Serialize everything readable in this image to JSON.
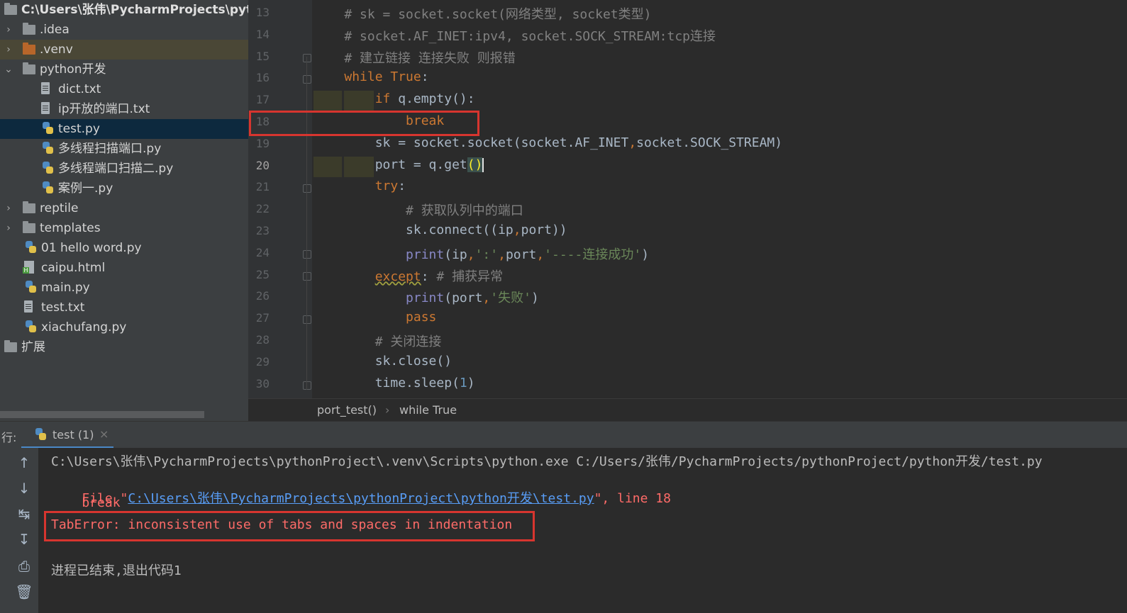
{
  "project_tree": {
    "root_path": "C:\\Users\\张伟\\PycharmProjects\\pytho",
    "items": [
      {
        "label": ".idea",
        "type": "folder",
        "expanded": false
      },
      {
        "label": ".venv",
        "type": "folder",
        "expanded": false,
        "icon_color": "#b8662a",
        "highlighted": true
      },
      {
        "label": "python开发",
        "type": "folder",
        "expanded": true
      },
      {
        "label": "dict.txt",
        "type": "txt"
      },
      {
        "label": "ip开放的端口.txt",
        "type": "txt"
      },
      {
        "label": "test.py",
        "type": "py",
        "selected": true
      },
      {
        "label": "多线程扫描端口.py",
        "type": "py"
      },
      {
        "label": "多线程端口扫描二.py",
        "type": "py"
      },
      {
        "label": "案例一.py",
        "type": "py"
      },
      {
        "label": "reptile",
        "type": "folder",
        "expanded": false
      },
      {
        "label": "templates",
        "type": "folder",
        "expanded": false
      },
      {
        "label": "01 hello word.py",
        "type": "py"
      },
      {
        "label": "caipu.html",
        "type": "html"
      },
      {
        "label": "main.py",
        "type": "py"
      },
      {
        "label": "test.txt",
        "type": "txt"
      },
      {
        "label": "xiachufang.py",
        "type": "py"
      },
      {
        "label": "扩展",
        "type": "folder"
      }
    ]
  },
  "editor": {
    "current_line": 20,
    "lines": [
      {
        "num": "13",
        "tokens": [
          {
            "t": "    # sk = socket.socket(网络类型, socket类型)",
            "c": "cm"
          }
        ]
      },
      {
        "num": "14",
        "tokens": [
          {
            "t": "    # socket.AF_INET:ipv4, socket.SOCK_STREAM:tcp连接",
            "c": "cm"
          }
        ]
      },
      {
        "num": "15",
        "tokens": [
          {
            "t": "    # 建立链接 连接失败 则报错",
            "c": "cm"
          }
        ]
      },
      {
        "num": "16",
        "tokens": [
          {
            "t": "    ",
            "c": ""
          },
          {
            "t": "while True",
            "c": "kw"
          },
          {
            "t": ":",
            "c": ""
          }
        ]
      },
      {
        "num": "17",
        "tokens": [
          {
            "t": "        ",
            "c": ""
          },
          {
            "t": "if",
            "c": "kw"
          },
          {
            "t": " q.empty():",
            "c": ""
          }
        ]
      },
      {
        "num": "18",
        "tokens": [
          {
            "t": "            ",
            "c": ""
          },
          {
            "t": "break",
            "c": "kw"
          }
        ]
      },
      {
        "num": "19",
        "tokens": [
          {
            "t": "        sk = socket.socket(socket.AF_INET",
            "c": ""
          },
          {
            "t": ",",
            "c": "kw"
          },
          {
            "t": "socket.SOCK_STREAM)",
            "c": ""
          }
        ]
      },
      {
        "num": "20",
        "tokens": [
          {
            "t": "        port = q.get",
            "c": ""
          },
          {
            "t": "()",
            "c": "brk"
          }
        ]
      },
      {
        "num": "21",
        "tokens": [
          {
            "t": "        ",
            "c": ""
          },
          {
            "t": "try",
            "c": "kw"
          },
          {
            "t": ":",
            "c": ""
          }
        ]
      },
      {
        "num": "22",
        "tokens": [
          {
            "t": "            # 获取队列中的端口",
            "c": "cm"
          }
        ]
      },
      {
        "num": "23",
        "tokens": [
          {
            "t": "            sk.connect((ip",
            "c": ""
          },
          {
            "t": ",",
            "c": "kw"
          },
          {
            "t": "port))",
            "c": ""
          }
        ]
      },
      {
        "num": "24",
        "tokens": [
          {
            "t": "            ",
            "c": ""
          },
          {
            "t": "print",
            "c": "bi"
          },
          {
            "t": "(ip",
            "c": ""
          },
          {
            "t": ",",
            "c": "kw"
          },
          {
            "t": "':'",
            "c": "st"
          },
          {
            "t": ",",
            "c": "kw"
          },
          {
            "t": "port",
            "c": ""
          },
          {
            "t": ",",
            "c": "kw"
          },
          {
            "t": "'----连接成功'",
            "c": "st"
          },
          {
            "t": ")",
            "c": ""
          }
        ]
      },
      {
        "num": "25",
        "tokens": [
          {
            "t": "        ",
            "c": ""
          },
          {
            "t": "except",
            "c": "kw"
          },
          {
            "t": ": ",
            "c": ""
          },
          {
            "t": "# 捕获异常",
            "c": "cm"
          }
        ]
      },
      {
        "num": "26",
        "tokens": [
          {
            "t": "            ",
            "c": ""
          },
          {
            "t": "print",
            "c": "bi"
          },
          {
            "t": "(port",
            "c": ""
          },
          {
            "t": ",",
            "c": "kw"
          },
          {
            "t": "'失败'",
            "c": "st"
          },
          {
            "t": ")",
            "c": ""
          }
        ]
      },
      {
        "num": "27",
        "tokens": [
          {
            "t": "            ",
            "c": ""
          },
          {
            "t": "pass",
            "c": "kw"
          }
        ]
      },
      {
        "num": "28",
        "tokens": [
          {
            "t": "        # 关闭连接",
            "c": "cm"
          }
        ]
      },
      {
        "num": "29",
        "tokens": [
          {
            "t": "        sk.close()",
            "c": ""
          }
        ]
      },
      {
        "num": "30",
        "tokens": [
          {
            "t": "        time.sleep(",
            "c": ""
          },
          {
            "t": "1",
            "c": "nm"
          },
          {
            "t": ")",
            "c": ""
          }
        ]
      }
    ],
    "breadcrumb": {
      "item1": "port_test()",
      "separator": "›",
      "item2": "while True"
    }
  },
  "run_panel": {
    "run_label": "行:",
    "tab_label": "test (1)",
    "close_glyph": "×",
    "output": {
      "command": "C:\\Users\\张伟\\PycharmProjects\\pythonProject\\.venv\\Scripts\\python.exe C:/Users/张伟/PycharmProjects/pythonProject/python开发/test.py",
      "file_prefix": "  File \"",
      "file_link": "C:\\Users\\张伟\\PycharmProjects\\pythonProject\\python开发\\test.py",
      "file_suffix": "\", line 18",
      "error_line": "    break",
      "error_message": "TabError: inconsistent use of tabs and spaces in indentation",
      "exit_message": "进程已结束,退出代码1"
    },
    "tools": [
      "up-arrow-icon",
      "down-arrow-icon",
      "soft-wrap-icon",
      "scroll-to-end-icon",
      "print-icon",
      "trash-icon"
    ]
  },
  "colors": {
    "annotation_red": "#d7352f",
    "keyword": "#cc7832",
    "comment": "#808080",
    "string": "#6a8759",
    "link": "#589df6",
    "error": "#ff6b68"
  }
}
